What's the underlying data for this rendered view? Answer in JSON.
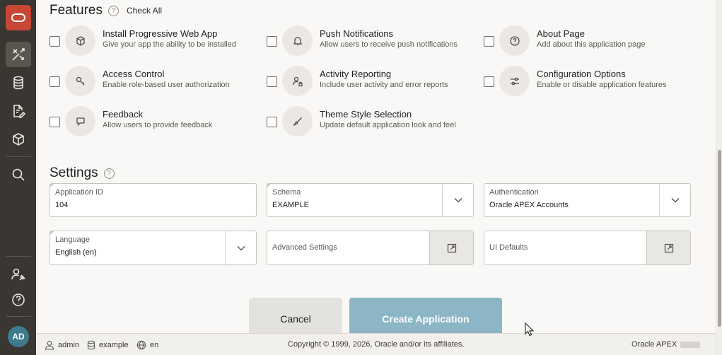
{
  "nav": {
    "items": [
      {
        "icon": "oracle-logo-icon"
      },
      {
        "icon": "app-builder-icon",
        "active": true
      },
      {
        "icon": "database-icon"
      },
      {
        "icon": "document-edit-icon"
      },
      {
        "icon": "package-icon"
      },
      {
        "icon": "search-icon"
      },
      {
        "icon": "admin-tools-icon"
      },
      {
        "icon": "help-icon"
      }
    ],
    "avatar": "AD"
  },
  "features": {
    "title": "Features",
    "help": "?",
    "check_all": "Check All",
    "items": [
      {
        "name": "Install Progressive Web App",
        "desc": "Give your app the ability to be installed",
        "icon": "package-icon",
        "checked": false
      },
      {
        "name": "Push Notifications",
        "desc": "Allow users to receive push notifications",
        "icon": "bell-icon",
        "checked": false
      },
      {
        "name": "About Page",
        "desc": "Add about this application page",
        "icon": "question-icon",
        "checked": false
      },
      {
        "name": "Access Control",
        "desc": "Enable role-based user authorization",
        "icon": "key-icon",
        "checked": false
      },
      {
        "name": "Activity Reporting",
        "desc": "Include user activity and error reports",
        "icon": "user-lock-icon",
        "checked": false
      },
      {
        "name": "Configuration Options",
        "desc": "Enable or disable application features",
        "icon": "sliders-icon",
        "checked": false
      },
      {
        "name": "Feedback",
        "desc": "Allow users to provide feedback",
        "icon": "speech-bubble-icon",
        "checked": false
      },
      {
        "name": "Theme Style Selection",
        "desc": "Update default application look and feel",
        "icon": "brush-icon",
        "checked": false
      }
    ]
  },
  "settings": {
    "title": "Settings",
    "help": "?",
    "application_id": {
      "label": "Application ID",
      "value": "104"
    },
    "schema": {
      "label": "Schema",
      "value": "EXAMPLE"
    },
    "authentication": {
      "label": "Authentication",
      "value": "Oracle APEX Accounts"
    },
    "language": {
      "label": "Language",
      "value": "English (en)"
    },
    "advanced": {
      "label": "Advanced Settings"
    },
    "ui_defaults": {
      "label": "UI Defaults"
    }
  },
  "actions": {
    "cancel": "Cancel",
    "create": "Create Application"
  },
  "footer": {
    "user": "admin",
    "workspace": "example",
    "language": "en",
    "copyright": "Copyright © 1999, 2026, Oracle and/or its affiliates.",
    "product": "Oracle APEX"
  },
  "colors": {
    "accent": "#c74634",
    "rail": "#3a3631",
    "primary_button": "#8cb6c6"
  }
}
